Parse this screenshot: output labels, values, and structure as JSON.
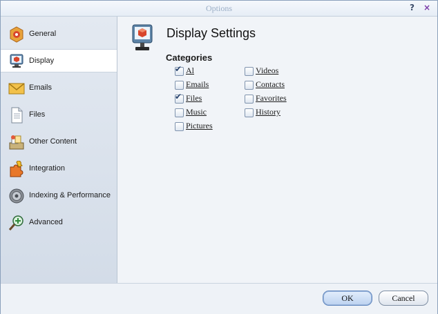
{
  "window": {
    "title": "Options",
    "help_label": "?",
    "close_label": "×"
  },
  "sidebar": {
    "items": [
      {
        "label": "General",
        "icon": "general-icon",
        "selected": false
      },
      {
        "label": "Display",
        "icon": "display-icon",
        "selected": true
      },
      {
        "label": "Emails",
        "icon": "email-icon",
        "selected": false
      },
      {
        "label": "Files",
        "icon": "files-icon",
        "selected": false
      },
      {
        "label": "Other Content",
        "icon": "other-content-icon",
        "selected": false
      },
      {
        "label": "Integration",
        "icon": "integration-icon",
        "selected": false
      },
      {
        "label": "Indexing & Performance",
        "icon": "indexing-icon",
        "selected": false
      },
      {
        "label": "Advanced",
        "icon": "advanced-icon",
        "selected": false
      }
    ]
  },
  "content": {
    "title": "Display Settings",
    "section_title": "Categories",
    "categories": [
      {
        "label": "Al",
        "checked": true
      },
      {
        "label": "Emails",
        "checked": false
      },
      {
        "label": "Files",
        "checked": true
      },
      {
        "label": "Music",
        "checked": false
      },
      {
        "label": "Pictures",
        "checked": false
      },
      {
        "label": "Videos",
        "checked": false
      },
      {
        "label": "Contacts",
        "checked": false
      },
      {
        "label": "Favorites",
        "checked": false
      },
      {
        "label": "History",
        "checked": false
      }
    ]
  },
  "footer": {
    "ok_label": "OK",
    "cancel_label": "Cancel"
  },
  "colors": {
    "accent": "#5f86be",
    "sidebar_bg": "#d8e0ea",
    "selected_bg": "#ffffff"
  }
}
